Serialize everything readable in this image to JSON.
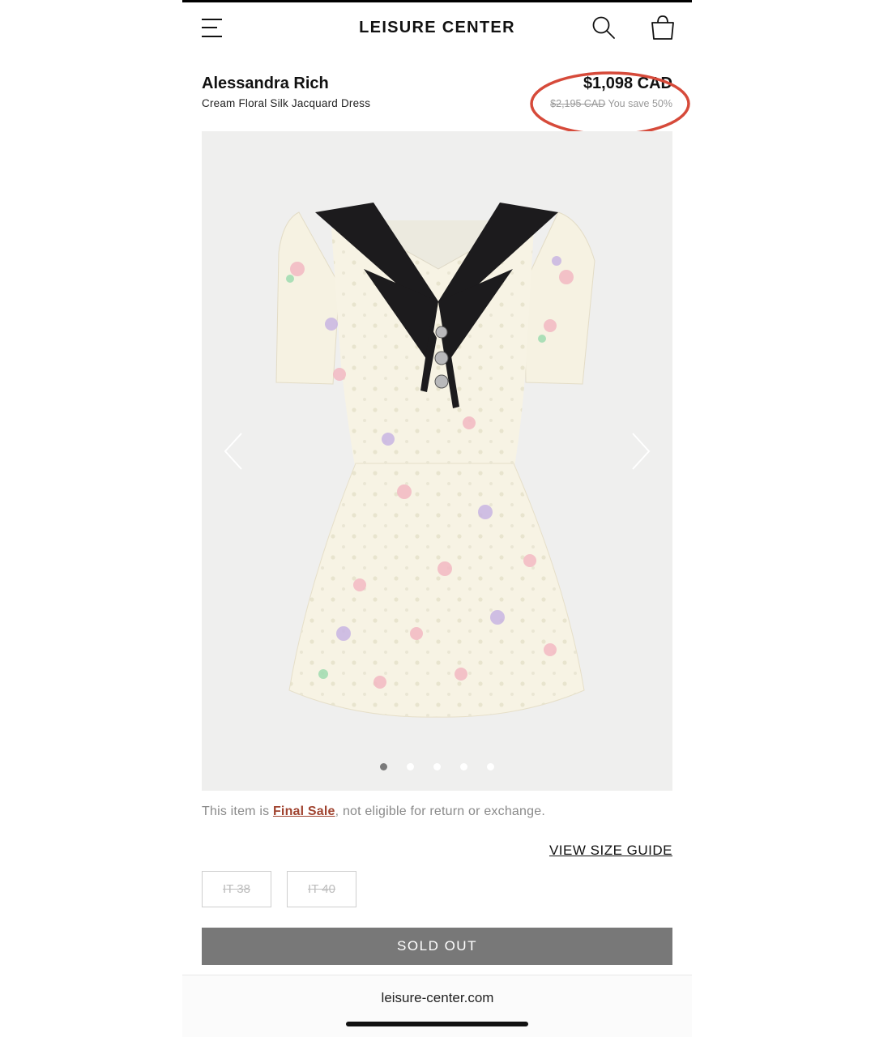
{
  "header": {
    "brand": "LEISURE CENTER",
    "menu_icon": "hamburger-menu-icon",
    "search_icon": "search-icon",
    "cart_icon": "shopping-bag-icon"
  },
  "product": {
    "brand": "Alessandra Rich",
    "name": "Cream Floral Silk Jacquard Dress",
    "price": "$1,098 CAD",
    "original_price": "$2,195 CAD",
    "savings": "You save 50%"
  },
  "gallery": {
    "image_count": 5,
    "active_index": 0,
    "prev_icon": "chevron-left-icon",
    "next_icon": "chevron-right-icon"
  },
  "notice": {
    "prefix": "This item is ",
    "link": "Final Sale",
    "suffix": ", not eligible for return or exchange."
  },
  "size_guide": "VIEW SIZE GUIDE",
  "sizes": [
    {
      "label": "IT 38",
      "available": false
    },
    {
      "label": "IT 40",
      "available": false
    }
  ],
  "cta": "SOLD OUT",
  "footer": {
    "url": "leisure-center.com"
  },
  "colors": {
    "annotation": "#d64a3a",
    "final_sale_link": "#a0432f",
    "sold_out_bg": "#787878"
  }
}
